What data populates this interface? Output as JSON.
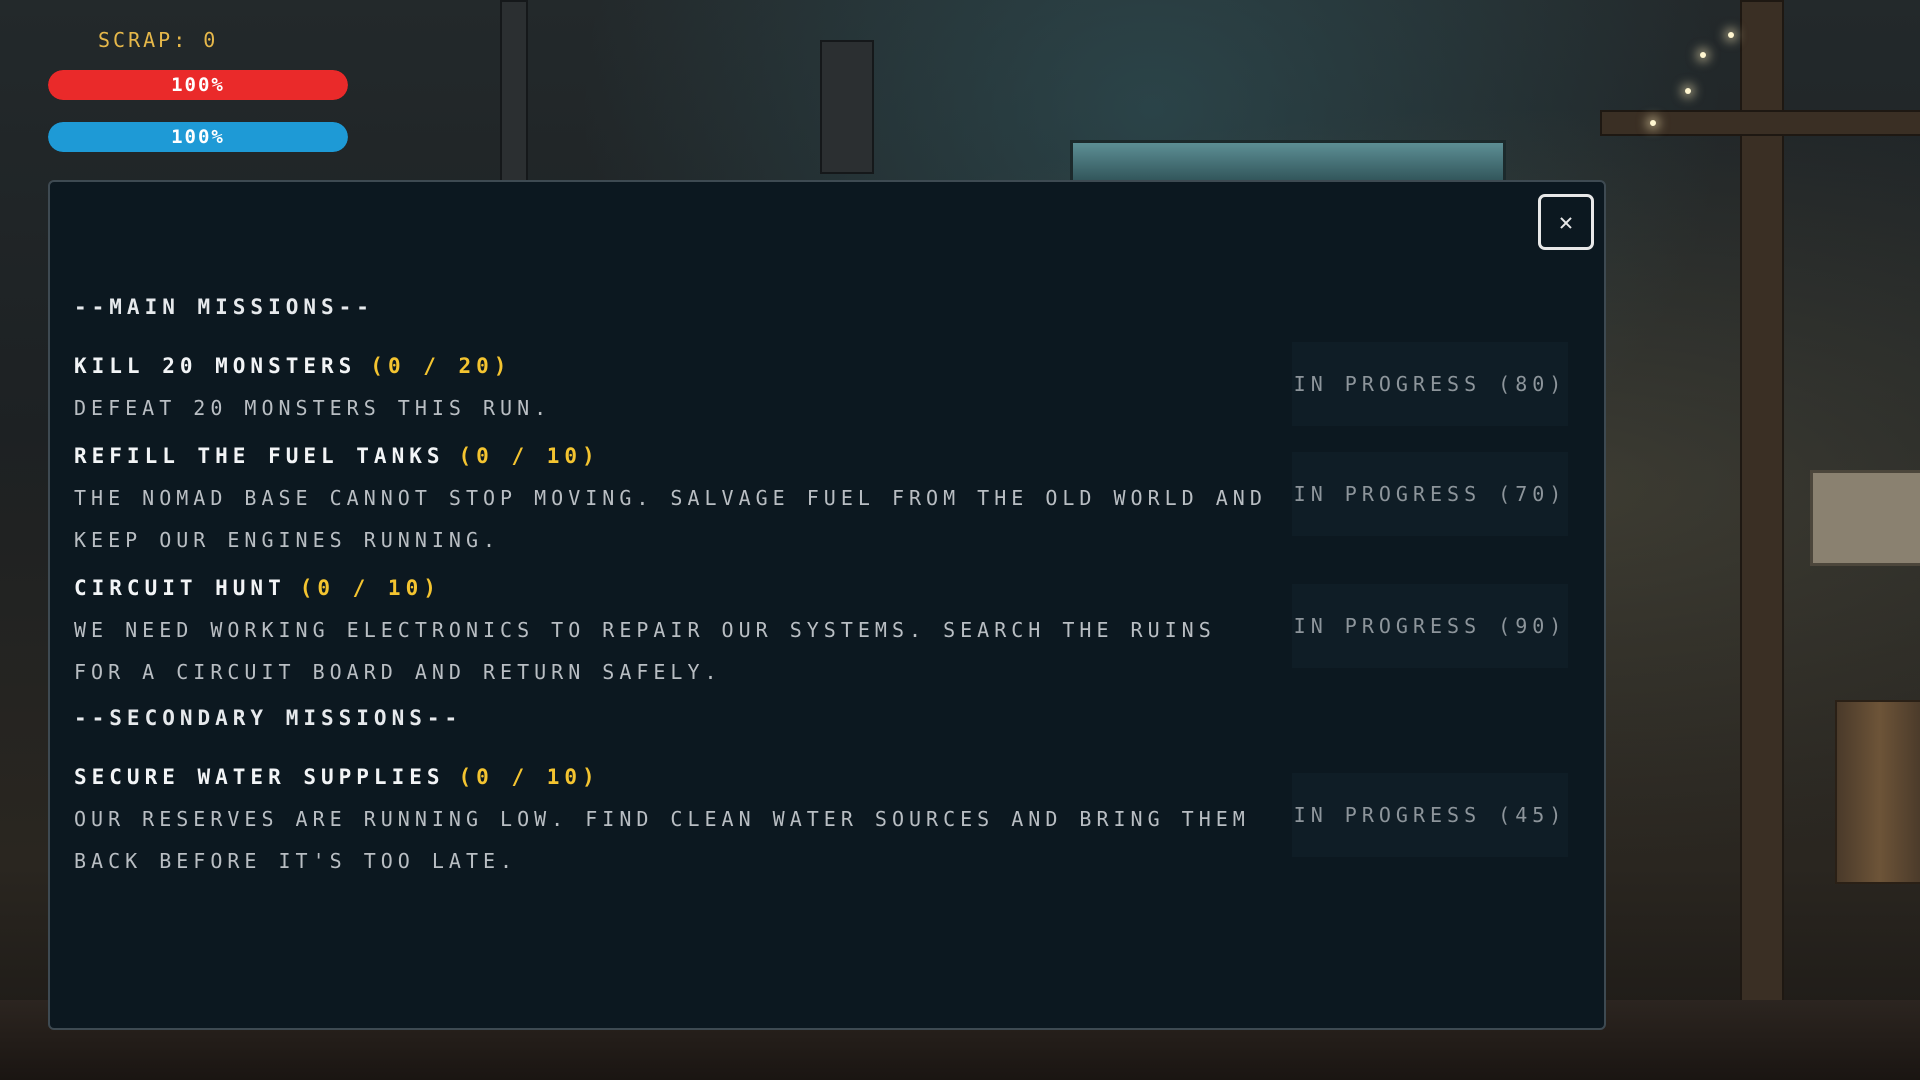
{
  "hud": {
    "scrap_label": "SCRAP: 0",
    "health": {
      "label": "100%",
      "fraction": 1.0,
      "color": "#ea2a2a"
    },
    "energy": {
      "label": "100%",
      "fraction": 1.0,
      "color": "#1e9ad6"
    }
  },
  "modal": {
    "close_glyph": "✕",
    "main_heading": "--MAIN MISSIONS--",
    "secondary_heading": "--SECONDARY MISSIONS--",
    "main_missions": [
      {
        "title": "KILL 20 MONSTERS",
        "count": "(0 / 20)",
        "description": "DEFEAT 20 MONSTERS THIS RUN.",
        "status": "IN PROGRESS (80)"
      },
      {
        "title": "REFILL THE FUEL TANKS",
        "count": "(0 / 10)",
        "description": "THE NOMAD BASE CANNOT STOP MOVING. SALVAGE FUEL FROM THE OLD WORLD AND KEEP OUR ENGINES RUNNING.",
        "status": "IN PROGRESS (70)"
      },
      {
        "title": "CIRCUIT HUNT",
        "count": "(0 / 10)",
        "description": "WE NEED WORKING ELECTRONICS TO REPAIR OUR SYSTEMS. SEARCH THE RUINS FOR A CIRCUIT BOARD AND RETURN SAFELY.",
        "status": "IN PROGRESS (90)"
      }
    ],
    "secondary_missions": [
      {
        "title": "SECURE WATER SUPPLIES",
        "count": "(0 / 10)",
        "description": "OUR RESERVES ARE RUNNING LOW. FIND CLEAN WATER SOURCES AND BRING THEM BACK BEFORE IT'S TOO LATE.",
        "status": "IN PROGRESS (45)"
      }
    ]
  }
}
